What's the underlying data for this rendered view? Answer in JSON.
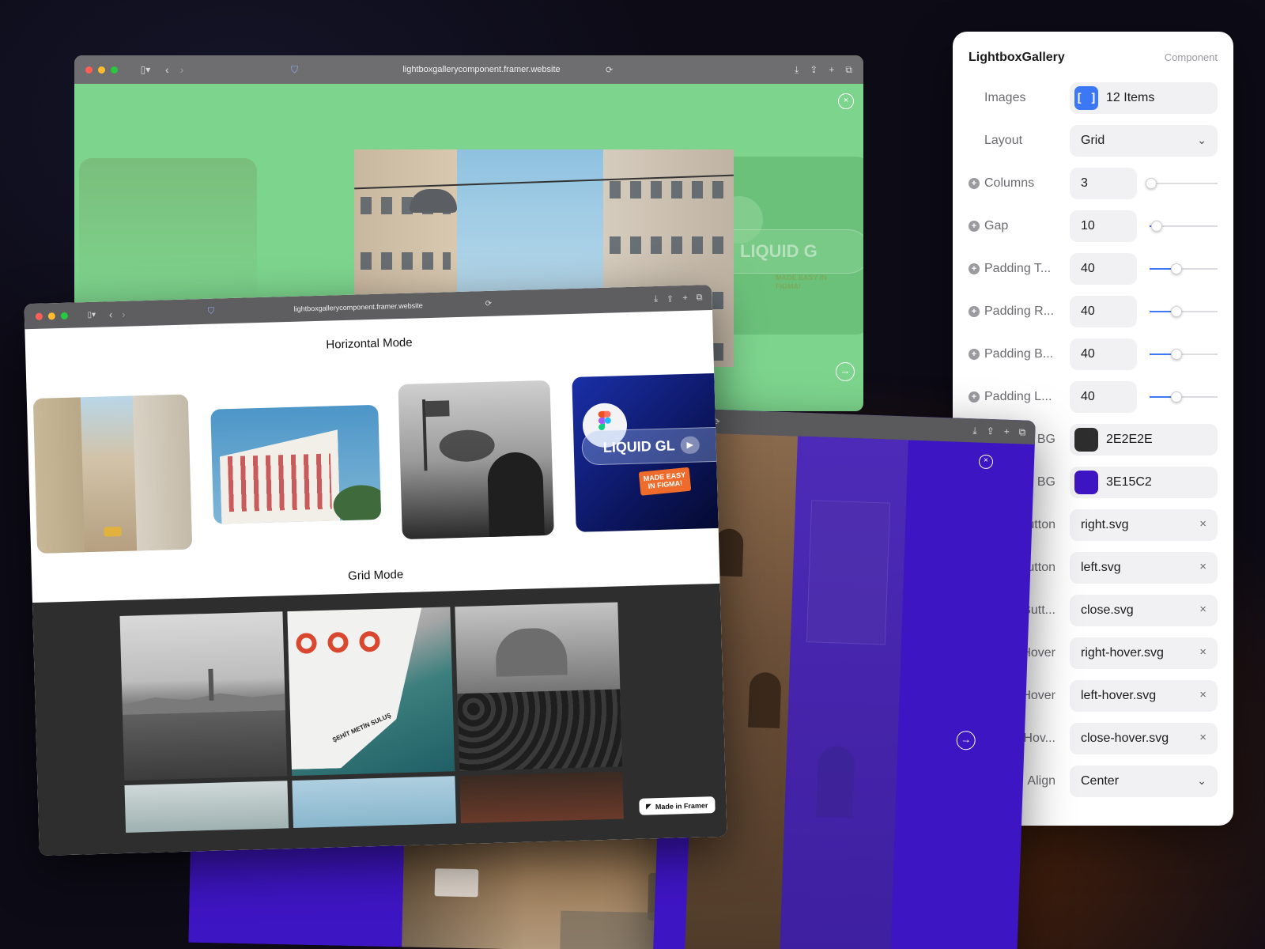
{
  "green_window": {
    "url": "lightboxgallerycomponent.framer.website",
    "ghost_text": "LIQUID G",
    "ghost_badge": "MADE EASY IN FIGMA!"
  },
  "white_window": {
    "url": "lightboxgallerycomponent.framer.website",
    "horizontal_title": "Horizontal Mode",
    "grid_title": "Grid Mode",
    "liquid_card_title": "LIQUID GL",
    "liquid_card_badge_1": "MADE EASY",
    "liquid_card_badge_2": "IN FIGMA!",
    "boat_name": "ŞEHİT METİN SULUŞ",
    "framer_badge": "Made in Framer"
  },
  "panel": {
    "title": "LightboxGallery",
    "subtitle": "Component",
    "rows": {
      "images": {
        "label": "Images",
        "value": "12 Items"
      },
      "layout": {
        "label": "Layout",
        "value": "Grid"
      },
      "columns": {
        "label": "Columns",
        "value": "3",
        "level": 0.02
      },
      "gap": {
        "label": "Gap",
        "value": "10",
        "level": 0.1
      },
      "padding_top": {
        "label": "Padding T...",
        "value": "40",
        "level": 0.4
      },
      "padding_right": {
        "label": "Padding R...",
        "value": "40",
        "level": 0.4
      },
      "padding_bottom": {
        "label": "Padding B...",
        "value": "40",
        "level": 0.4
      },
      "padding_left": {
        "label": "Padding L...",
        "value": "40",
        "level": 0.4
      },
      "bg": {
        "label": "BG",
        "value": "2E2E2E",
        "color": "#2E2E2E"
      },
      "lightbox_bg": {
        "label": "x BG",
        "value": "3E15C2",
        "color": "#3E15C2"
      },
      "right_button": {
        "label": "utton",
        "value": "right.svg"
      },
      "left_button": {
        "label": "utton",
        "value": "left.svg"
      },
      "close_button": {
        "label": "Butt...",
        "value": "close.svg"
      },
      "right_hover": {
        "label": "Hover",
        "value": "right-hover.svg"
      },
      "left_hover": {
        "label": "Hover",
        "value": "left-hover.svg"
      },
      "close_hover": {
        "label": "Hov...",
        "value": "close-hover.svg"
      },
      "align": {
        "label": "Align",
        "value": "Center"
      }
    }
  },
  "colors": {
    "green_bg": "#7DD58D",
    "grid_bg": "#2E2E2E",
    "lightbox_bg": "#3E15C2",
    "accent": "#3C78F5"
  },
  "icons": {
    "close": "close-circle-icon",
    "next": "arrow-right-circle-icon",
    "array": "array-brackets-icon",
    "chevron": "chevron-down-icon",
    "clear": "clear-x-icon",
    "add": "plus-circle-icon"
  }
}
